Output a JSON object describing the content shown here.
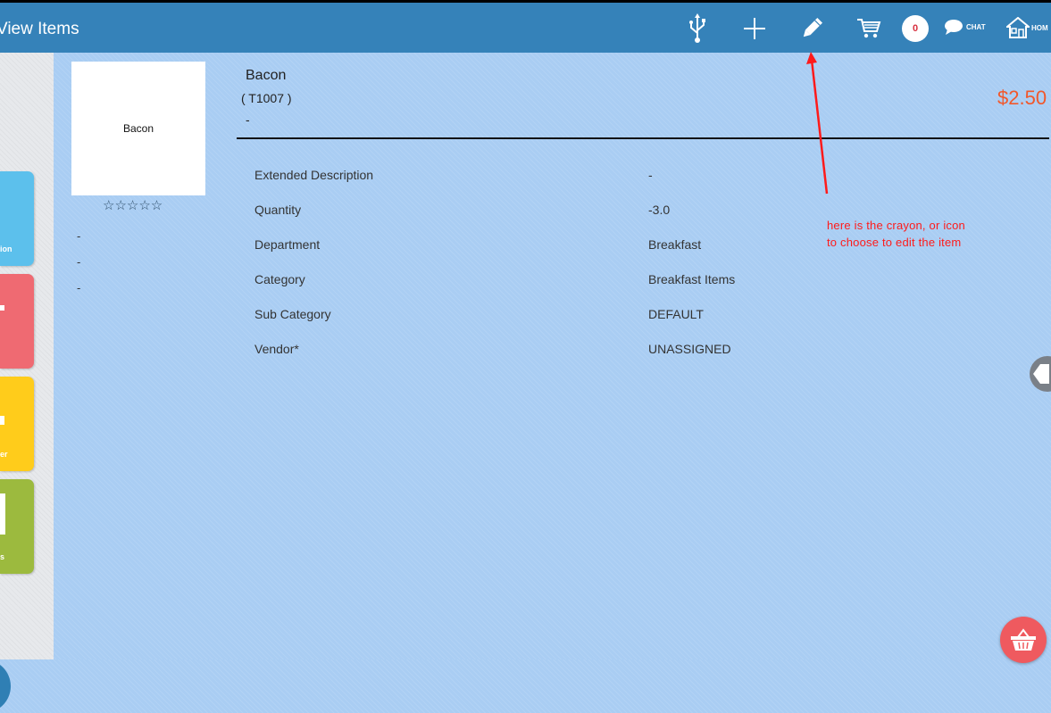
{
  "header": {
    "title": "View Items",
    "cart_count": "0",
    "chat_label": "CHAT",
    "home_label": "HOM",
    "icons": [
      "usb-icon",
      "add-icon",
      "pencil-icon",
      "cart-icon",
      "chat-icon",
      "home-icon"
    ]
  },
  "sidebar": {
    "tiles": [
      {
        "label": "ion",
        "color": "#5cc0ec"
      },
      {
        "label": "",
        "color": "#ef6a72"
      },
      {
        "label": "er",
        "color": "#ffcc1b"
      },
      {
        "label": "s",
        "color": "#9cba3e"
      }
    ]
  },
  "item": {
    "image_label": "Bacon",
    "rating": "☆☆☆☆☆",
    "side_values": [
      "-",
      "-",
      "-"
    ],
    "name": "Bacon",
    "code": "( T1007 )",
    "subtitle": "-",
    "price": "$2.50",
    "details": [
      {
        "label": "Extended Description",
        "value": "-"
      },
      {
        "label": "Quantity",
        "value": "-3.0"
      },
      {
        "label": "Department",
        "value": "Breakfast"
      },
      {
        "label": "Category",
        "value": "Breakfast Items"
      },
      {
        "label": "Sub Category",
        "value": "DEFAULT"
      },
      {
        "label": "Vendor*",
        "value": "UNASSIGNED"
      }
    ]
  },
  "annotation": {
    "line1": "here is the crayon, or icon",
    "line2": "to choose to edit the item",
    "color": "#ff1a1a"
  },
  "colors": {
    "topbar": "#3582b9",
    "background": "#a9cdf3",
    "price": "#f2572a",
    "basket": "#ef5a5f"
  }
}
